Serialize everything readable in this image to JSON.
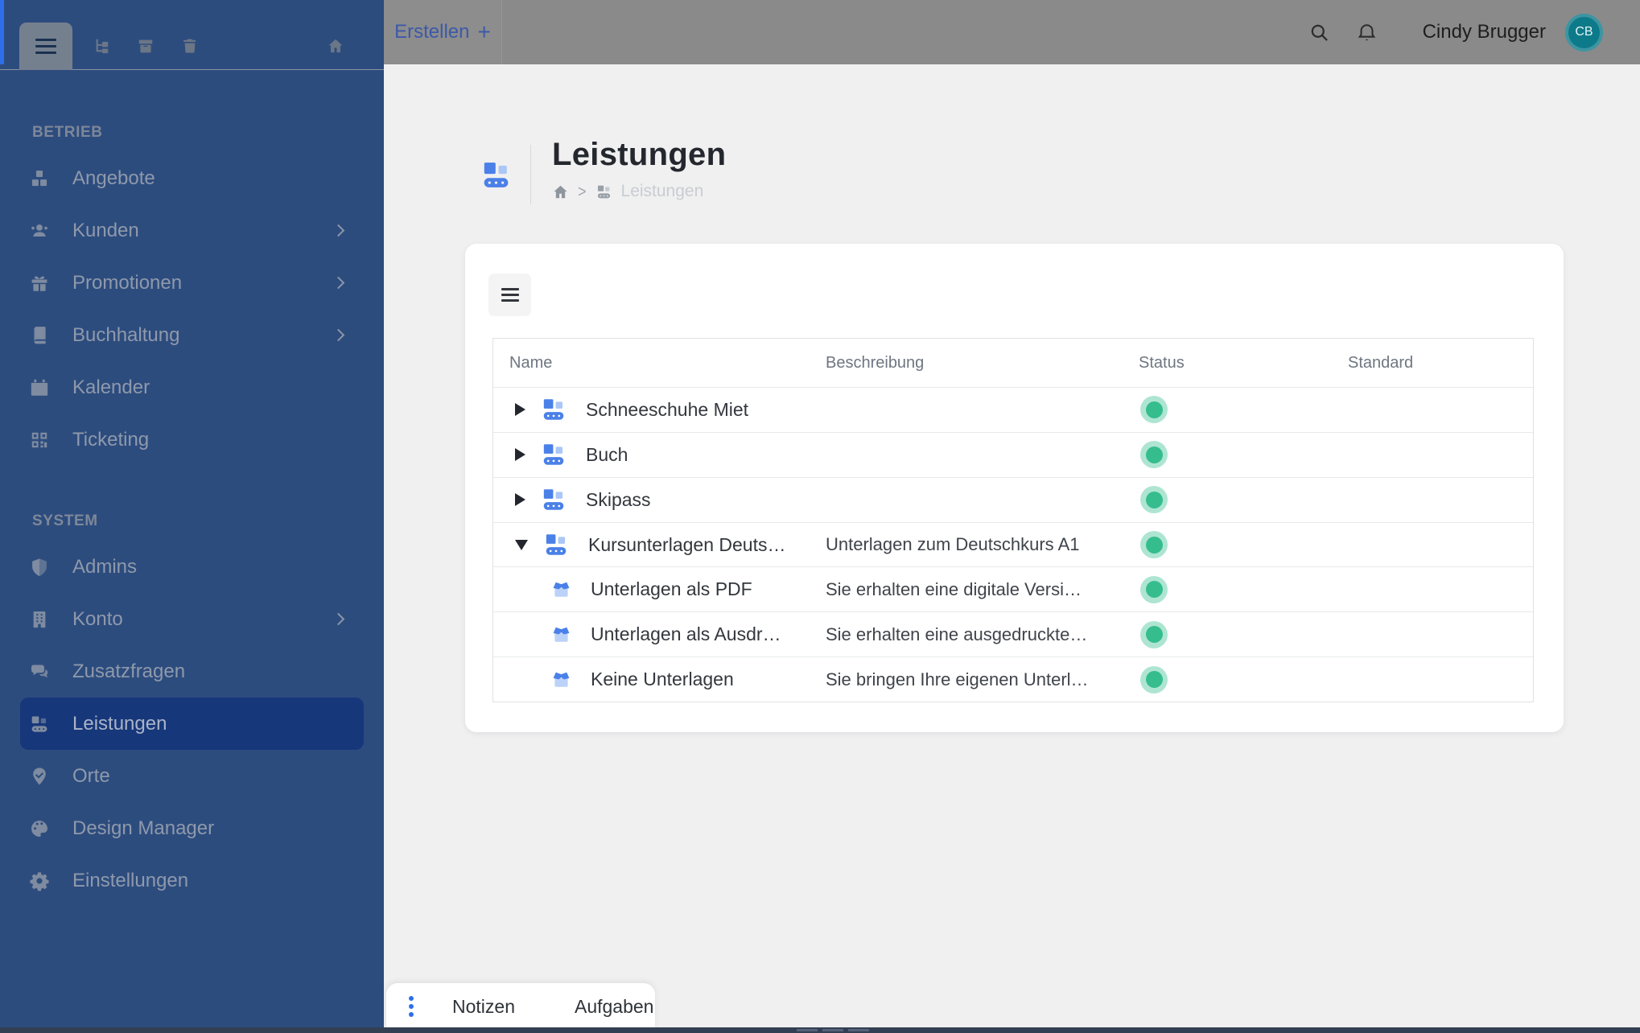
{
  "colors": {
    "accent": "#4a80e8",
    "accent_light": "#abc7f7",
    "accent_bright": "#2e6fe9",
    "sidebar_bg": "#2d4c7e",
    "sidebar_active": "#17377b",
    "status_green": "#35bd8d",
    "status_ring": "#aee5d2",
    "avatar_teal": "#0d7a89"
  },
  "topbar": {
    "create_label": "Erstellen",
    "create_plus": "+",
    "user_name": "Cindy Brugger",
    "avatar_initials": "CB"
  },
  "sidebar": {
    "header_icons": [
      "hamburger-icon",
      "sitemap-icon",
      "archive-icon",
      "trash-icon",
      "home-icon"
    ],
    "sections": [
      {
        "label": "BETRIEB",
        "items": [
          {
            "label": "Angebote",
            "icon": "cubes-icon",
            "chevron": false,
            "active": false
          },
          {
            "label": "Kunden",
            "icon": "users-icon",
            "chevron": true,
            "active": false
          },
          {
            "label": "Promotionen",
            "icon": "gift-icon",
            "chevron": true,
            "active": false
          },
          {
            "label": "Buchhaltung",
            "icon": "book-icon",
            "chevron": true,
            "active": false
          },
          {
            "label": "Kalender",
            "icon": "calendar-icon",
            "chevron": false,
            "active": false
          },
          {
            "label": "Ticketing",
            "icon": "qr-icon",
            "chevron": false,
            "active": false
          }
        ]
      },
      {
        "label": "SYSTEM",
        "items": [
          {
            "label": "Admins",
            "icon": "shield-icon",
            "chevron": false,
            "active": false
          },
          {
            "label": "Konto",
            "icon": "building-icon",
            "chevron": true,
            "active": false
          },
          {
            "label": "Zusatzfragen",
            "icon": "chat-icon",
            "chevron": false,
            "active": false
          },
          {
            "label": "Leistungen",
            "icon": "conveyor-icon",
            "chevron": false,
            "active": true
          },
          {
            "label": "Orte",
            "icon": "pin-icon",
            "chevron": false,
            "active": false
          },
          {
            "label": "Design Manager",
            "icon": "palette-icon",
            "chevron": false,
            "active": false
          },
          {
            "label": "Einstellungen",
            "icon": "gear-icon",
            "chevron": false,
            "active": false
          }
        ]
      }
    ]
  },
  "page": {
    "title": "Leistungen",
    "title_icon": "conveyor-color-icon",
    "breadcrumb": {
      "home_icon": "home-icon",
      "separator": ">",
      "glyph": "conveyor-gray-icon",
      "current": "Leistungen"
    }
  },
  "table": {
    "columns": [
      "Name",
      "Beschreibung",
      "Status",
      "Standard"
    ],
    "rows": [
      {
        "name": "Schneeschuhe Miet",
        "description": "",
        "level": 0,
        "expanded": false,
        "has_children": true,
        "icon": "conveyor-color-icon",
        "status": "active",
        "standard": ""
      },
      {
        "name": "Buch",
        "description": "",
        "level": 0,
        "expanded": false,
        "has_children": true,
        "icon": "conveyor-color-icon",
        "status": "active",
        "standard": ""
      },
      {
        "name": "Skipass",
        "description": "",
        "level": 0,
        "expanded": false,
        "has_children": true,
        "icon": "conveyor-color-icon",
        "status": "active",
        "standard": ""
      },
      {
        "name": "Kursunterlagen Deuts…",
        "description": "Unterlagen zum Deutschkurs A1",
        "level": 0,
        "expanded": true,
        "has_children": true,
        "icon": "conveyor-color-icon",
        "status": "active",
        "standard": ""
      },
      {
        "name": "Unterlagen als PDF",
        "description": "Sie erhalten eine digitale Versi…",
        "level": 1,
        "expanded": false,
        "has_children": false,
        "icon": "box-open-icon",
        "status": "active",
        "standard": ""
      },
      {
        "name": "Unterlagen als Ausdr…",
        "description": "Sie erhalten eine ausgedruckte…",
        "level": 1,
        "expanded": false,
        "has_children": false,
        "icon": "box-open-icon",
        "status": "active",
        "standard": ""
      },
      {
        "name": "Keine Unterlagen",
        "description": "Sie bringen Ihre eigenen Unterl…",
        "level": 1,
        "expanded": false,
        "has_children": false,
        "icon": "box-open-icon",
        "status": "active",
        "standard": ""
      }
    ]
  },
  "bottom_bar": {
    "menu_icon": "kebab-icon",
    "tabs": [
      "Notizen",
      "Aufgaben"
    ]
  }
}
